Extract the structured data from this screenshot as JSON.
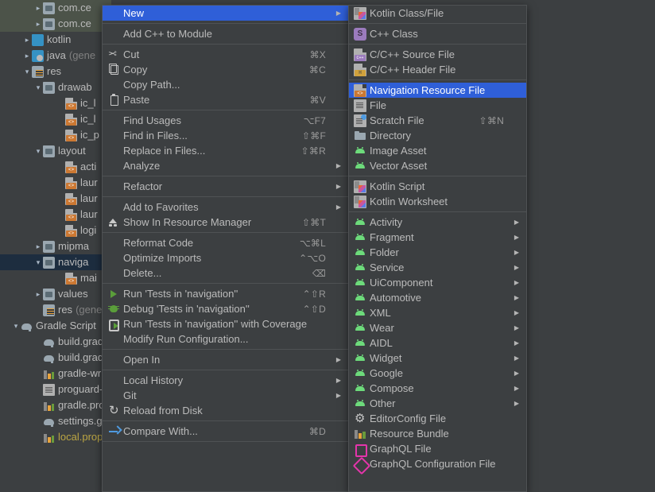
{
  "app": {
    "theme_bg": "#3c3f41",
    "accent_blue": "#2f5fd8",
    "tree_select_green": "#4c5349",
    "tree_select_blue": "#1d2d3f"
  },
  "sidebar": {
    "name": "project-tree",
    "items": [
      {
        "label": "com.ce",
        "chevron": "›",
        "icon": "folder-icon",
        "indent": 3,
        "state": "selected-green",
        "muted": false
      },
      {
        "label": "com.ce",
        "chevron": "›",
        "icon": "folder-icon",
        "indent": 3,
        "state": "selected-green",
        "muted": false
      },
      {
        "label": "kotlin",
        "chevron": "›",
        "icon": "folder-blue-icon",
        "indent": 2,
        "state": "none",
        "muted": false
      },
      {
        "label": "java",
        "suffix": "(gene",
        "chevron": "›",
        "icon": "folder-java-icon",
        "indent": 2,
        "state": "none",
        "muted": false
      },
      {
        "label": "res",
        "chevron": "⌄",
        "icon": "folder-res-icon",
        "indent": 2,
        "state": "none",
        "muted": false
      },
      {
        "label": "drawab",
        "chevron": "⌄",
        "icon": "folder-icon",
        "indent": 3,
        "state": "none",
        "muted": false
      },
      {
        "label": "ic_l",
        "chevron": "",
        "icon": "xml-file-icon",
        "indent": 5,
        "state": "none",
        "muted": false
      },
      {
        "label": "ic_l",
        "chevron": "",
        "icon": "xml-file-icon",
        "indent": 5,
        "state": "none",
        "muted": false
      },
      {
        "label": "ic_p",
        "chevron": "",
        "icon": "xml-file-icon",
        "indent": 5,
        "state": "none",
        "muted": false
      },
      {
        "label": "layout",
        "chevron": "⌄",
        "icon": "folder-icon",
        "indent": 3,
        "state": "none",
        "muted": false
      },
      {
        "label": "acti",
        "chevron": "",
        "icon": "xml-file-icon",
        "indent": 5,
        "state": "none",
        "muted": false
      },
      {
        "label": "laur",
        "chevron": "",
        "icon": "xml-file-icon",
        "indent": 5,
        "state": "none",
        "muted": false
      },
      {
        "label": "laur",
        "chevron": "",
        "icon": "xml-file-icon",
        "indent": 5,
        "state": "none",
        "muted": false
      },
      {
        "label": "laur",
        "chevron": "",
        "icon": "xml-file-icon",
        "indent": 5,
        "state": "none",
        "muted": false
      },
      {
        "label": "logi",
        "chevron": "",
        "icon": "xml-file-icon",
        "indent": 5,
        "state": "none",
        "muted": false
      },
      {
        "label": "mipma",
        "chevron": "›",
        "icon": "folder-icon",
        "indent": 3,
        "state": "none",
        "muted": false
      },
      {
        "label": "naviga",
        "chevron": "⌄",
        "icon": "folder-icon",
        "indent": 3,
        "state": "selected-blue",
        "muted": false
      },
      {
        "label": "mai",
        "chevron": "",
        "icon": "xml-file-icon",
        "indent": 5,
        "state": "none",
        "muted": false
      },
      {
        "label": "values",
        "chevron": "›",
        "icon": "folder-icon",
        "indent": 3,
        "state": "none",
        "muted": false
      },
      {
        "label": "res",
        "suffix": "(gene",
        "chevron": "",
        "icon": "folder-res-icon",
        "indent": 3,
        "state": "none",
        "muted": false
      },
      {
        "label": "Gradle Script",
        "chevron": "⌄",
        "icon": "gradle-icon",
        "indent": 1,
        "state": "none",
        "muted": false
      },
      {
        "label": "build.grad",
        "chevron": "",
        "icon": "gradle-icon",
        "indent": 3,
        "state": "none",
        "muted": false
      },
      {
        "label": "build.grad",
        "chevron": "",
        "icon": "gradle-icon",
        "indent": 3,
        "state": "none",
        "muted": false
      },
      {
        "label": "gradle-wr",
        "chevron": "",
        "icon": "properties-icon",
        "indent": 3,
        "state": "none",
        "muted": false
      },
      {
        "label": "proguard-",
        "chevron": "",
        "icon": "text-file-icon",
        "indent": 3,
        "state": "none",
        "muted": false
      },
      {
        "label": "gradle.pro",
        "chevron": "",
        "icon": "properties-icon",
        "indent": 3,
        "state": "none",
        "muted": false
      },
      {
        "label": "settings.g",
        "chevron": "",
        "icon": "gradle-icon",
        "indent": 3,
        "state": "none",
        "muted": false
      },
      {
        "label": "local.prop",
        "chevron": "",
        "icon": "properties-icon",
        "indent": 3,
        "state": "none",
        "muted": false,
        "color": "yellow"
      }
    ]
  },
  "context_menu": {
    "name": "file-context-menu",
    "items": [
      {
        "type": "item",
        "label": "New",
        "icon": "",
        "shortcut": "",
        "arrow": true,
        "selected": true
      },
      {
        "type": "separator"
      },
      {
        "type": "item",
        "label": "Add C++ to Module",
        "icon": "",
        "shortcut": "",
        "arrow": false
      },
      {
        "type": "separator"
      },
      {
        "type": "item",
        "label": "Cut",
        "icon": "cut-icon",
        "shortcut": "⌘X",
        "arrow": false
      },
      {
        "type": "item",
        "label": "Copy",
        "icon": "copy-icon",
        "shortcut": "⌘C",
        "arrow": false
      },
      {
        "type": "item",
        "label": "Copy Path...",
        "icon": "",
        "shortcut": "",
        "arrow": false
      },
      {
        "type": "item",
        "label": "Paste",
        "icon": "paste-icon",
        "shortcut": "⌘V",
        "arrow": false
      },
      {
        "type": "separator"
      },
      {
        "type": "item",
        "label": "Find Usages",
        "icon": "",
        "shortcut": "⌥F7",
        "arrow": false
      },
      {
        "type": "item",
        "label": "Find in Files...",
        "icon": "",
        "shortcut": "⇧⌘F",
        "arrow": false
      },
      {
        "type": "item",
        "label": "Replace in Files...",
        "icon": "",
        "shortcut": "⇧⌘R",
        "arrow": false
      },
      {
        "type": "item",
        "label": "Analyze",
        "icon": "",
        "shortcut": "",
        "arrow": true
      },
      {
        "type": "separator"
      },
      {
        "type": "item",
        "label": "Refactor",
        "icon": "",
        "shortcut": "",
        "arrow": true
      },
      {
        "type": "separator"
      },
      {
        "type": "item",
        "label": "Add to Favorites",
        "icon": "",
        "shortcut": "",
        "arrow": true
      },
      {
        "type": "item",
        "label": "Show In Resource Manager",
        "icon": "resource-manager-icon",
        "shortcut": "⇧⌘T",
        "arrow": false
      },
      {
        "type": "separator"
      },
      {
        "type": "item",
        "label": "Reformat Code",
        "icon": "",
        "shortcut": "⌥⌘L",
        "arrow": false
      },
      {
        "type": "item",
        "label": "Optimize Imports",
        "icon": "",
        "shortcut": "⌃⌥O",
        "arrow": false
      },
      {
        "type": "item",
        "label": "Delete...",
        "icon": "",
        "shortcut": "⌫",
        "arrow": false
      },
      {
        "type": "separator"
      },
      {
        "type": "item",
        "label": "Run 'Tests in 'navigation''",
        "icon": "run-icon",
        "shortcut": "⌃⇧R",
        "arrow": false
      },
      {
        "type": "item",
        "label": "Debug 'Tests in 'navigation''",
        "icon": "debug-icon",
        "shortcut": "⌃⇧D",
        "arrow": false
      },
      {
        "type": "item",
        "label": "Run 'Tests in 'navigation'' with Coverage",
        "icon": "coverage-icon",
        "shortcut": "",
        "arrow": false
      },
      {
        "type": "item",
        "label": "Modify Run Configuration...",
        "icon": "",
        "shortcut": "",
        "arrow": false
      },
      {
        "type": "separator"
      },
      {
        "type": "item",
        "label": "Open In",
        "icon": "",
        "shortcut": "",
        "arrow": true
      },
      {
        "type": "separator"
      },
      {
        "type": "item",
        "label": "Local History",
        "icon": "",
        "shortcut": "",
        "arrow": true
      },
      {
        "type": "item",
        "label": "Git",
        "icon": "",
        "shortcut": "",
        "arrow": true
      },
      {
        "type": "item",
        "label": "Reload from Disk",
        "icon": "reload-icon",
        "shortcut": "",
        "arrow": false
      },
      {
        "type": "separator"
      },
      {
        "type": "item",
        "label": "Compare With...",
        "icon": "compare-icon",
        "shortcut": "⌘D",
        "arrow": false
      },
      {
        "type": "separator"
      }
    ]
  },
  "new_submenu": {
    "name": "new-submenu",
    "items": [
      {
        "type": "item",
        "label": "Kotlin Class/File",
        "icon": "kotlin-file-icon",
        "shortcut": "",
        "arrow": false
      },
      {
        "type": "separator"
      },
      {
        "type": "item",
        "label": "C++ Class",
        "icon": "cpp-class-icon",
        "shortcut": "",
        "arrow": false
      },
      {
        "type": "separator"
      },
      {
        "type": "item",
        "label": "C/C++ Source File",
        "icon": "cpp-source-icon",
        "shortcut": "",
        "arrow": false
      },
      {
        "type": "item",
        "label": "C/C++ Header File",
        "icon": "cpp-header-icon",
        "shortcut": "",
        "arrow": false
      },
      {
        "type": "separator"
      },
      {
        "type": "item",
        "label": "Navigation Resource File",
        "icon": "navigation-resource-icon",
        "shortcut": "",
        "arrow": false,
        "selected": true
      },
      {
        "type": "item",
        "label": "File",
        "icon": "file-icon",
        "shortcut": "",
        "arrow": false
      },
      {
        "type": "item",
        "label": "Scratch File",
        "icon": "scratch-file-icon",
        "shortcut": "⇧⌘N",
        "arrow": false
      },
      {
        "type": "item",
        "label": "Directory",
        "icon": "directory-icon",
        "shortcut": "",
        "arrow": false
      },
      {
        "type": "item",
        "label": "Image Asset",
        "icon": "android-icon",
        "shortcut": "",
        "arrow": false
      },
      {
        "type": "item",
        "label": "Vector Asset",
        "icon": "android-icon",
        "shortcut": "",
        "arrow": false
      },
      {
        "type": "separator"
      },
      {
        "type": "item",
        "label": "Kotlin Script",
        "icon": "kotlin-script-icon",
        "shortcut": "",
        "arrow": false
      },
      {
        "type": "item",
        "label": "Kotlin Worksheet",
        "icon": "kotlin-script-icon",
        "shortcut": "",
        "arrow": false
      },
      {
        "type": "separator"
      },
      {
        "type": "item",
        "label": "Activity",
        "icon": "android-icon",
        "shortcut": "",
        "arrow": true
      },
      {
        "type": "item",
        "label": "Fragment",
        "icon": "android-icon",
        "shortcut": "",
        "arrow": true
      },
      {
        "type": "item",
        "label": "Folder",
        "icon": "android-icon",
        "shortcut": "",
        "arrow": true
      },
      {
        "type": "item",
        "label": "Service",
        "icon": "android-icon",
        "shortcut": "",
        "arrow": true
      },
      {
        "type": "item",
        "label": "UiComponent",
        "icon": "android-icon",
        "shortcut": "",
        "arrow": true
      },
      {
        "type": "item",
        "label": "Automotive",
        "icon": "android-icon",
        "shortcut": "",
        "arrow": true
      },
      {
        "type": "item",
        "label": "XML",
        "icon": "android-icon",
        "shortcut": "",
        "arrow": true
      },
      {
        "type": "item",
        "label": "Wear",
        "icon": "android-icon",
        "shortcut": "",
        "arrow": true
      },
      {
        "type": "item",
        "label": "AIDL",
        "icon": "android-icon",
        "shortcut": "",
        "arrow": true
      },
      {
        "type": "item",
        "label": "Widget",
        "icon": "android-icon",
        "shortcut": "",
        "arrow": true
      },
      {
        "type": "item",
        "label": "Google",
        "icon": "android-icon",
        "shortcut": "",
        "arrow": true
      },
      {
        "type": "item",
        "label": "Compose",
        "icon": "android-icon",
        "shortcut": "",
        "arrow": true
      },
      {
        "type": "item",
        "label": "Other",
        "icon": "android-icon",
        "shortcut": "",
        "arrow": true
      },
      {
        "type": "item",
        "label": "EditorConfig File",
        "icon": "gear-icon",
        "shortcut": "",
        "arrow": false
      },
      {
        "type": "item",
        "label": "Resource Bundle",
        "icon": "resource-bundle-icon",
        "shortcut": "",
        "arrow": false
      },
      {
        "type": "item",
        "label": "GraphQL File",
        "icon": "graphql-file-icon",
        "shortcut": "",
        "arrow": false
      },
      {
        "type": "item",
        "label": "GraphQL Configuration File",
        "icon": "graphql-config-icon",
        "shortcut": "",
        "arrow": false
      }
    ]
  }
}
